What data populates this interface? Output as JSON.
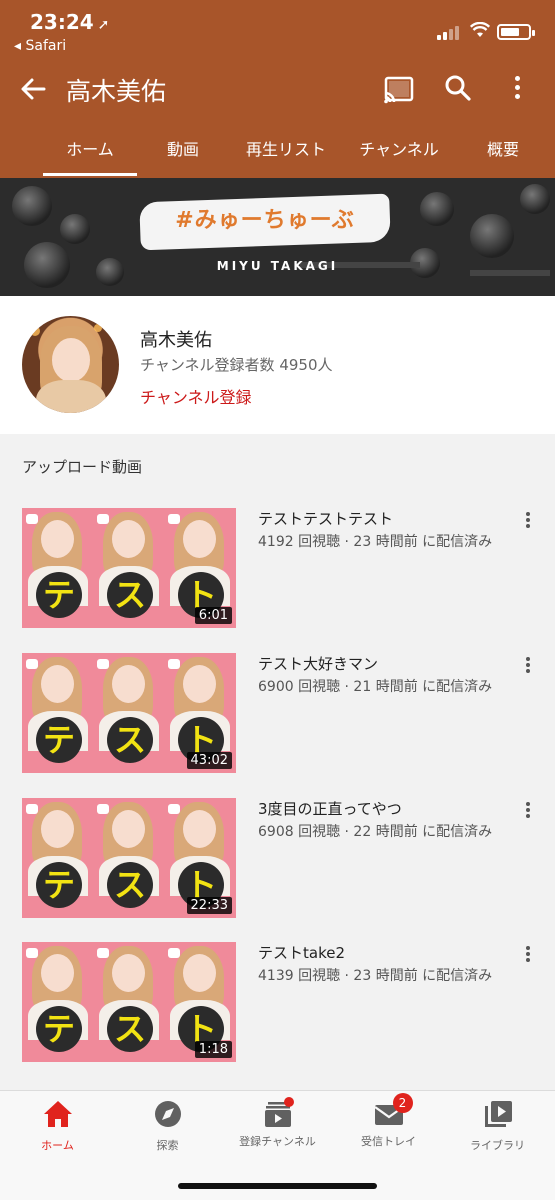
{
  "status_bar": {
    "time": "23:24",
    "back_app": "◂ Safari"
  },
  "app_bar": {
    "channel_title": "高木美佑",
    "icons": [
      "back-arrow-icon",
      "cast-icon",
      "search-icon",
      "more-vert-icon"
    ]
  },
  "tabs": [
    {
      "label": "ホーム",
      "active": true
    },
    {
      "label": "動画"
    },
    {
      "label": "再生リスト"
    },
    {
      "label": "チャンネル"
    },
    {
      "label": "概要"
    }
  ],
  "banner": {
    "title": "#みゅーちゅーぶ",
    "subtitle": "MIYU TAKAGI"
  },
  "channel": {
    "name": "高木美佑",
    "subscribers": "チャンネル登録者数 4950人",
    "subscribe_label": "チャンネル登録"
  },
  "uploads": {
    "section_title": "アップロード動画",
    "thumb_chars": [
      "テ",
      "ス",
      "ト"
    ],
    "videos": [
      {
        "title": "テストテストテスト",
        "meta": "4192 回視聴 · 23 時間前 に配信済み",
        "duration": "6:01"
      },
      {
        "title": "テスト大好きマン",
        "meta": "6900 回視聴 · 21 時間前 に配信済み",
        "duration": "43:02"
      },
      {
        "title": "3度目の正直ってやつ",
        "meta": "6908 回視聴 · 22 時間前 に配信済み",
        "duration": "22:33"
      },
      {
        "title": "テストtake2",
        "meta": "4139 回視聴 · 23 時間前 に配信済み",
        "duration": "1:18"
      }
    ]
  },
  "bottom_nav": [
    {
      "label": "ホーム",
      "icon": "home-icon",
      "active": true
    },
    {
      "label": "探索",
      "icon": "explore-icon"
    },
    {
      "label": "登録チャンネル",
      "icon": "subscriptions-icon"
    },
    {
      "label": "受信トレイ",
      "icon": "inbox-icon",
      "badge": "2"
    },
    {
      "label": "ライブラリ",
      "icon": "library-icon"
    }
  ],
  "colors": {
    "header": "#a8552a",
    "accent": "#e0231d"
  }
}
